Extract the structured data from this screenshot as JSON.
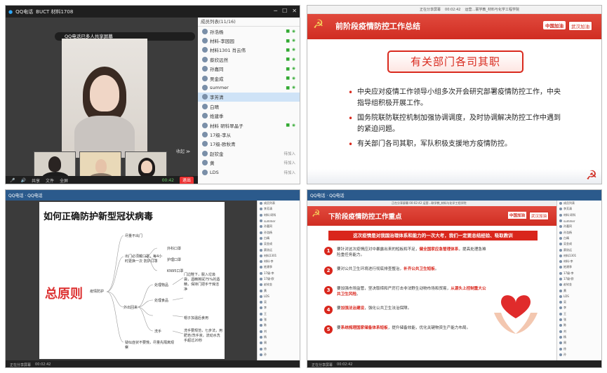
{
  "panel1": {
    "app_name": "QQ电话",
    "group_name": "BUCT 材料1708",
    "banner": "QQ电话已多人共享屏幕",
    "members_header": "成员列表(11/16)",
    "members": [
      {
        "name": "孙浩杨",
        "status": "on"
      },
      {
        "name": "材料-李园园",
        "status": "on"
      },
      {
        "name": "材料1301 肖云伟",
        "status": "on"
      },
      {
        "name": "蔡欣远然",
        "status": "on"
      },
      {
        "name": "孙嘉同",
        "status": "on"
      },
      {
        "name": "吴金成",
        "status": "on"
      },
      {
        "name": "summer",
        "status": "on"
      },
      {
        "name": "李芳清",
        "status": "",
        "selected": true
      },
      {
        "name": "白晴",
        "status": ""
      },
      {
        "name": "姓建季",
        "status": ""
      },
      {
        "name": "材料 研科翠晶子",
        "status": "on"
      },
      {
        "name": "17级-李从",
        "status": ""
      },
      {
        "name": "17级-欧秋青",
        "status": ""
      },
      {
        "name": "赵钦金",
        "status": "待加入"
      },
      {
        "name": "黄",
        "status": "待加入"
      },
      {
        "name": "LDS",
        "status": "待加入"
      }
    ],
    "controls": [
      "🎤",
      "🔊",
      "共享",
      "文件",
      "全屏"
    ],
    "time": "00:42",
    "exit_label": "退出",
    "collapse_label": "收起 ≫"
  },
  "panel2": {
    "window_tabs": [
      "正在分享屏幕",
      "00:02:42",
      "运营…联学教_材料与化学工程学院"
    ],
    "heading": "前阶段疫情防控工作总结",
    "tag1": "中国加油",
    "tag2": "武汉加油",
    "subheading": "有关部门各司其职",
    "bullets": [
      "中央应对疫情工作领导小组多次开会研究部署疫情防控工作，中央指导组积极开展工作。",
      "国务院联防联控机制加强协调调度，及时协调解决防控工作中遇到的紧迫问题。",
      "有关部门各司其职，军队积极支援地方疫情防控。"
    ]
  },
  "panel3": {
    "window_title": "QQ电话 · QQ电话",
    "tinybar": "正在分享屏幕  00:02:42  运营…联学教_材料与化学工程学院",
    "doc_title": "如何正确防护新型冠状病毒",
    "big_text": "总原则",
    "root": "疫情防护",
    "nodes": [
      "尽量不出门",
      "出门必须戴口罩，每4小时更换一次  防护口罩",
      "外科口罩",
      "护理口罩",
      "KN95口罩",
      "门边鞋下，脱入垃圾袋，酒精擦拭75%的酒精，保持门把手干燥洁净",
      "外出回来",
      "处理物品",
      "处理食品",
      "洗手",
      "帽子加温后食用",
      "洗手要规范，七步法，用肥皂/洗手液，流动水洗手超过20秒",
      "疑似症状不要慌，尽量先隔离观察"
    ],
    "bottom": [
      "正在分享屏幕",
      "00:02:42"
    ],
    "side_items": [
      "成员列表",
      "李芳清",
      "材料 研科",
      "summer",
      "孙嘉同",
      "孙浩杨",
      "白晴",
      "吴金成",
      "蔡欣远",
      "材料1301",
      "材料-李",
      "姓建季",
      "17级-李",
      "17级-欧",
      "赵钦金",
      "黄",
      "LDS",
      "吴",
      "李",
      "王",
      "张",
      "陈",
      "刘",
      "杨",
      "周",
      "徐",
      "孙"
    ]
  },
  "panel4": {
    "window_title": "QQ电话 · QQ电话",
    "tinybar": "正在分享屏幕  00:02:42  运营…联学教_材料与化学工程学院",
    "heading": "下阶段疫情防控工作重点",
    "tag1": "中国加油",
    "tag2": "武汉加油",
    "ribbon": "这次疫情是对我国治理体系和能力的一次大考，我们一定要总结经验、吸取教训",
    "items": [
      {
        "num": "1",
        "text": "要针对这次疫情应对中暴露出来的短板和不足，",
        "hl": "健全国家应急管理体系",
        "tail": "，提高处理急难险重任务能力。"
      },
      {
        "num": "2",
        "text": "要对公共卫生环境进行彻底排查整治，",
        "hl": "补齐公共卫生短板",
        "tail": "。"
      },
      {
        "num": "3",
        "text": "要加强市场监管，坚决取缔和严厉打击非法野生动物市场和贸易，",
        "hl": "从源头上控制重大公共卫生风险",
        "tail": "。"
      },
      {
        "num": "4",
        "text": "要",
        "hl": "加强法治建设",
        "tail": "，强化公共卫生法治保障。"
      },
      {
        "num": "5",
        "text": "要",
        "hl": "系统梳理国家储备体系短板",
        "tail": "，提升储备效能，优化关键物资生产能力布局。"
      }
    ],
    "bottom": [
      "正在分享屏幕",
      "00:02:42"
    ],
    "side_items": [
      "成员列表",
      "李芳清",
      "材料 研科",
      "summer",
      "孙嘉同",
      "孙浩杨",
      "白晴",
      "吴金成",
      "蔡欣远",
      "材料1301",
      "材料-李",
      "姓建季",
      "17级-李",
      "17级-欧",
      "赵钦金",
      "黄",
      "LDS",
      "吴",
      "李",
      "王",
      "张",
      "陈",
      "刘",
      "杨",
      "周",
      "徐",
      "孙"
    ]
  },
  "colors": {
    "party_red": "#d02d22",
    "gold": "#f6d15a",
    "qq_blue": "#2b5a8c"
  }
}
